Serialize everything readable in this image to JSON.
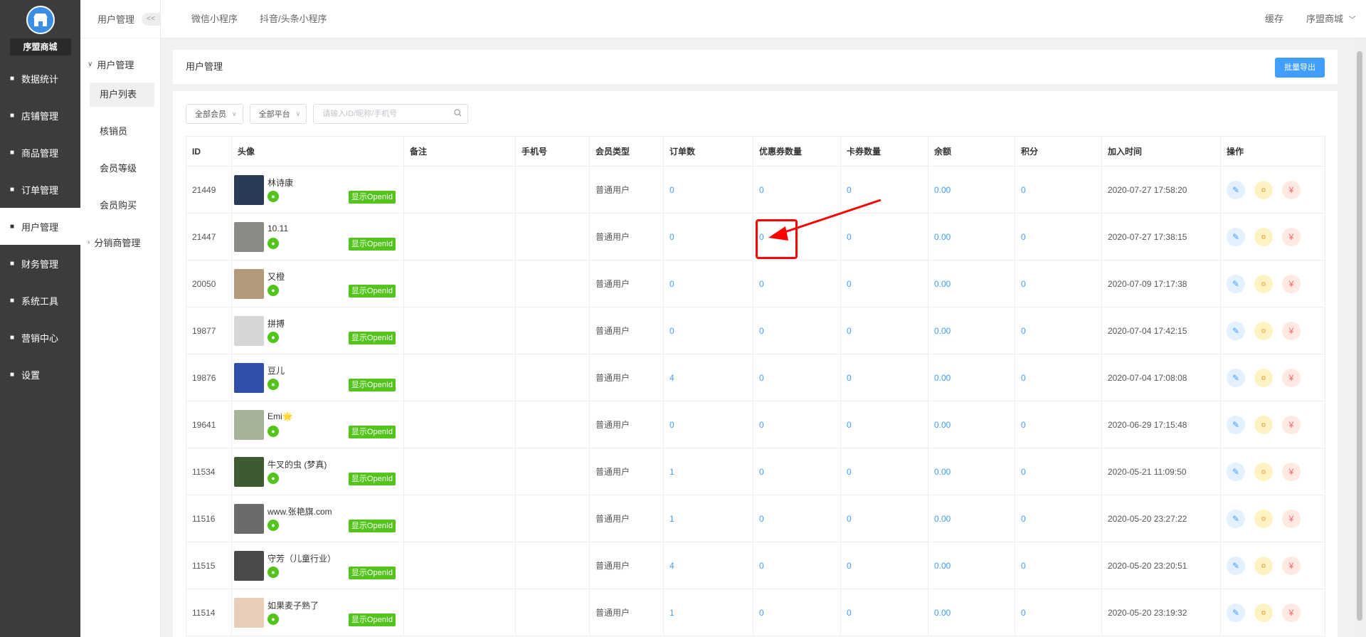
{
  "brand": {
    "name": "序盟商城"
  },
  "sidebar": {
    "items": [
      {
        "label": "数据统计",
        "icon": "chart-line-icon"
      },
      {
        "label": "店铺管理",
        "icon": "store-icon"
      },
      {
        "label": "商品管理",
        "icon": "product-icon"
      },
      {
        "label": "订单管理",
        "icon": "order-icon"
      },
      {
        "label": "用户管理",
        "icon": "user-icon",
        "active": true
      },
      {
        "label": "财务管理",
        "icon": "finance-icon"
      },
      {
        "label": "系统工具",
        "icon": "wrench-icon"
      },
      {
        "label": "营销中心",
        "icon": "marketing-icon"
      },
      {
        "label": "设置",
        "icon": "gear-icon"
      }
    ]
  },
  "subnav": {
    "header": "用户管理",
    "collapse_label": "<<",
    "group1": "用户管理",
    "items": [
      "用户列表",
      "核销员",
      "会员等级",
      "会员购买"
    ],
    "group2": "分销商管理"
  },
  "topbar": {
    "tabs": [
      "微信小程序",
      "抖音/头条小程序"
    ],
    "cache": "缓存",
    "account": "序盟商城"
  },
  "page": {
    "title": "用户管理",
    "export_label": "批量导出"
  },
  "filters": {
    "member": "全部会员",
    "platform": "全部平台",
    "search_placeholder": "请输入ID/昵称/手机号"
  },
  "table": {
    "headers": [
      "ID",
      "头像",
      "备注",
      "手机号",
      "会员类型",
      "订单数",
      "优惠券数量",
      "卡券数量",
      "余额",
      "积分",
      "加入时间",
      "操作"
    ],
    "openid_label": "显示OpenId",
    "rows": [
      {
        "id": "21449",
        "name": "林诗康",
        "remark": "",
        "phone": "",
        "type": "普通用户",
        "orders": "0",
        "coupons": "0",
        "cards": "0",
        "balance": "0.00",
        "points": "0",
        "joined": "2020-07-27 17:58:20",
        "avatar_color": "#2b3a55"
      },
      {
        "id": "21447",
        "name": "10.11",
        "remark": "",
        "phone": "",
        "type": "普通用户",
        "orders": "0",
        "coupons": "0",
        "cards": "0",
        "balance": "0.00",
        "points": "0",
        "joined": "2020-07-27 17:38:15",
        "avatar_color": "#8a8a84"
      },
      {
        "id": "20050",
        "name": "又橙",
        "remark": "",
        "phone": "",
        "type": "普通用户",
        "orders": "0",
        "coupons": "0",
        "cards": "0",
        "balance": "0.00",
        "points": "0",
        "joined": "2020-07-09 17:17:38",
        "avatar_color": "#b39a7a"
      },
      {
        "id": "19877",
        "name": "拼搏",
        "remark": "",
        "phone": "",
        "type": "普通用户",
        "orders": "0",
        "coupons": "0",
        "cards": "0",
        "balance": "0.00",
        "points": "0",
        "joined": "2020-07-04 17:42:15",
        "avatar_color": "#d6d6d6"
      },
      {
        "id": "19876",
        "name": "豆儿",
        "remark": "",
        "phone": "",
        "type": "普通用户",
        "orders": "4",
        "coupons": "0",
        "cards": "0",
        "balance": "0.00",
        "points": "0",
        "joined": "2020-07-04 17:08:08",
        "avatar_color": "#2f4fa8"
      },
      {
        "id": "19641",
        "name": "Emi🌟",
        "remark": "",
        "phone": "",
        "type": "普通用户",
        "orders": "0",
        "coupons": "0",
        "cards": "0",
        "balance": "0.00",
        "points": "0",
        "joined": "2020-06-29 17:15:48",
        "avatar_color": "#a7b29a"
      },
      {
        "id": "11534",
        "name": "牛叉的虫 (梦真)",
        "remark": "",
        "phone": "",
        "type": "普通用户",
        "orders": "1",
        "coupons": "0",
        "cards": "0",
        "balance": "0.00",
        "points": "0",
        "joined": "2020-05-21 11:09:50",
        "avatar_color": "#3f5a33"
      },
      {
        "id": "11516",
        "name": "www.张艳旗.com",
        "remark": "",
        "phone": "",
        "type": "普通用户",
        "orders": "1",
        "coupons": "0",
        "cards": "0",
        "balance": "0.00",
        "points": "0",
        "joined": "2020-05-20 23:27:22",
        "avatar_color": "#6b6b6b"
      },
      {
        "id": "11515",
        "name": "守芳（儿童行业）",
        "remark": "",
        "phone": "",
        "type": "普通用户",
        "orders": "4",
        "coupons": "0",
        "cards": "0",
        "balance": "0.00",
        "points": "0",
        "joined": "2020-05-20 23:20:51",
        "avatar_color": "#4a4a4a"
      },
      {
        "id": "11514",
        "name": "如果麦子熟了",
        "remark": "",
        "phone": "",
        "type": "普通用户",
        "orders": "1",
        "coupons": "0",
        "cards": "0",
        "balance": "0.00",
        "points": "0",
        "joined": "2020-05-20 23:19:32",
        "avatar_color": "#e8cdb8"
      }
    ]
  },
  "colors": {
    "primary": "#409eff",
    "wechat_green": "#52c41a",
    "sidebar_bg": "#3c3c3c",
    "annotation_red": "#ff0000"
  }
}
